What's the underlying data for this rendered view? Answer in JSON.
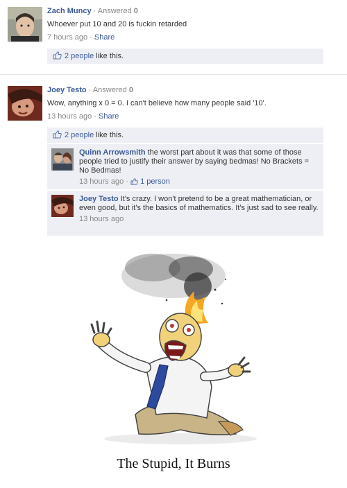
{
  "posts": [
    {
      "author": "Zach Muncy",
      "answered_label": "Answered",
      "answered_count": "0",
      "text": "Whoever put 10 and 20 is fuckin retarded",
      "time": "7 hours ago",
      "share_label": "Share",
      "likes": "2 people",
      "likes_suffix": "like this."
    },
    {
      "author": "Joey Testo",
      "answered_label": "Answered",
      "answered_count": "0",
      "text": "Wow, anything x 0 = 0. I can't believe how many people said '10'.",
      "time": "13 hours ago",
      "share_label": "Share",
      "likes": "2 people",
      "likes_suffix": "like this."
    }
  ],
  "comments": [
    {
      "author": "Quinn Arrowsmith",
      "text": "the worst part about it was that some of those people tried to justify their answer by saying bedmas! No Brackets = No Bedmas!",
      "time": "13 hours ago",
      "likes": "1 person"
    },
    {
      "author": "Joey Testo",
      "text": "It's crazy. I won't pretend to be a great mathematician, or even good, but it's the basics of mathematics. It's just sad to see really.",
      "time": "13 hours ago"
    }
  ],
  "caption": "The Stupid, It Burns",
  "icons": {
    "like": "thumbs-up-icon"
  },
  "colors": {
    "link": "#3b5998",
    "panel": "#edeff4",
    "meta": "#888888"
  }
}
